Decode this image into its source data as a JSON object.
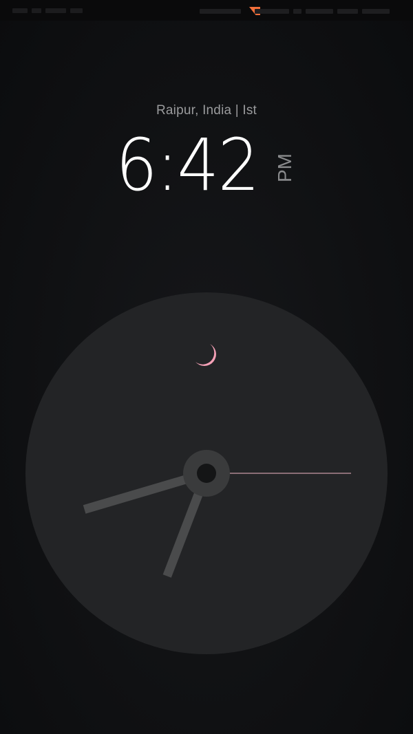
{
  "location": "Raipur, India | Ist",
  "time": {
    "display": "6:42",
    "period": "PM",
    "hours": 6,
    "minutes": 42,
    "seconds": 15
  },
  "icons": {
    "night": "crescent-moon-icon"
  },
  "colors": {
    "background": "#0e0f11",
    "dial": "#232426",
    "hands": "#4a4b4c",
    "second_hand": "#c79aa6",
    "moon": "#f4a0b6",
    "notification": "#f26f3a"
  }
}
